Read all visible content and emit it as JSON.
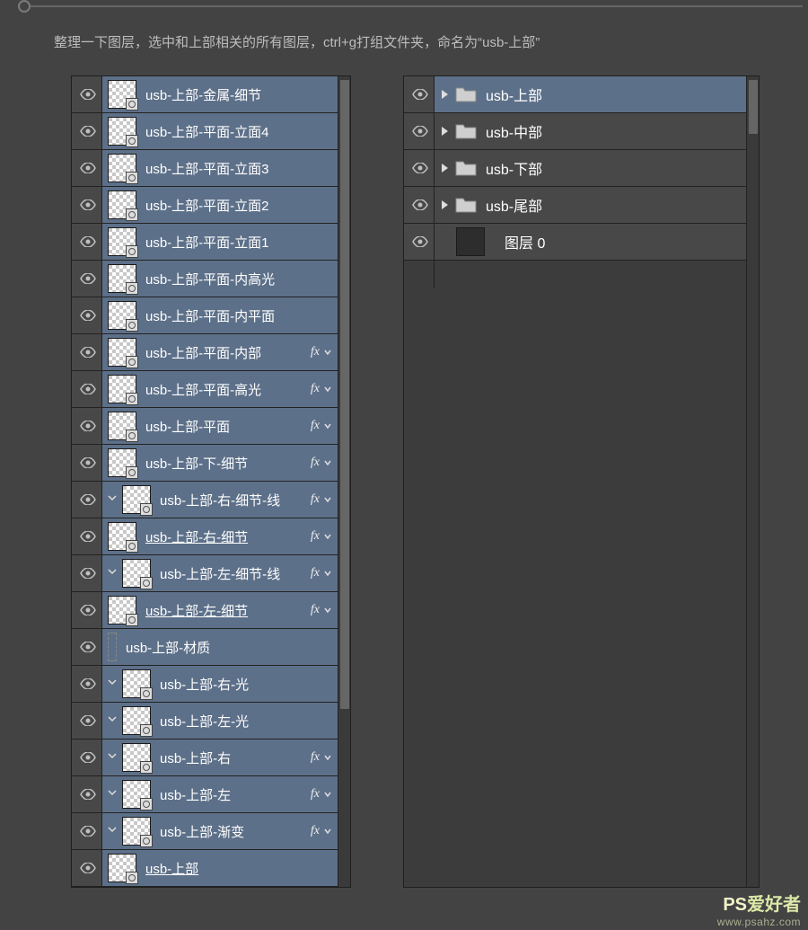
{
  "instruction": "整理一下图层，选中和上部相关的所有图层，ctrl+g打组文件夹，命名为“usb-上部”",
  "panelA": {
    "layers": [
      {
        "name": "usb-上部-金属-细节",
        "fx": false,
        "clip": false,
        "under": false,
        "mask": true
      },
      {
        "name": "usb-上部-平面-立面4",
        "fx": false,
        "clip": false,
        "under": false,
        "mask": true
      },
      {
        "name": "usb-上部-平面-立面3",
        "fx": false,
        "clip": false,
        "under": false,
        "mask": true
      },
      {
        "name": "usb-上部-平面-立面2",
        "fx": false,
        "clip": false,
        "under": false,
        "mask": true
      },
      {
        "name": "usb-上部-平面-立面1",
        "fx": false,
        "clip": false,
        "under": false,
        "mask": true
      },
      {
        "name": "usb-上部-平面-内高光",
        "fx": false,
        "clip": false,
        "under": false,
        "mask": true
      },
      {
        "name": "usb-上部-平面-内平面",
        "fx": false,
        "clip": false,
        "under": false,
        "mask": true
      },
      {
        "name": "usb-上部-平面-内部",
        "fx": true,
        "clip": false,
        "under": false,
        "mask": true
      },
      {
        "name": "usb-上部-平面-高光",
        "fx": true,
        "clip": false,
        "under": false,
        "mask": true
      },
      {
        "name": "usb-上部-平面",
        "fx": true,
        "clip": false,
        "under": false,
        "mask": true
      },
      {
        "name": "usb-上部-下-细节",
        "fx": true,
        "clip": false,
        "under": false,
        "mask": true
      },
      {
        "name": "usb-上部-右-细节-线",
        "fx": true,
        "clip": true,
        "under": false,
        "mask": true
      },
      {
        "name": "usb-上部-右-细节 ",
        "fx": true,
        "clip": false,
        "under": true,
        "mask": true
      },
      {
        "name": "usb-上部-左-细节-线",
        "fx": true,
        "clip": true,
        "under": false,
        "mask": true
      },
      {
        "name": "usb-上部-左-细节 ",
        "fx": true,
        "clip": false,
        "under": true,
        "mask": true
      },
      {
        "name": "usb-上部-材质",
        "fx": false,
        "clip": false,
        "under": false,
        "mask": false,
        "nothumb": true
      },
      {
        "name": "usb-上部-右-光",
        "fx": false,
        "clip": true,
        "under": false,
        "mask": true
      },
      {
        "name": "usb-上部-左-光",
        "fx": false,
        "clip": true,
        "under": false,
        "mask": true
      },
      {
        "name": "usb-上部-右",
        "fx": true,
        "clip": true,
        "under": false,
        "mask": true
      },
      {
        "name": "usb-上部-左",
        "fx": true,
        "clip": true,
        "under": false,
        "mask": true
      },
      {
        "name": "usb-上部-渐变",
        "fx": true,
        "clip": true,
        "under": false,
        "mask": true
      },
      {
        "name": "usb-上部 ",
        "fx": false,
        "clip": false,
        "under": true,
        "mask": true
      }
    ]
  },
  "panelB": {
    "rows": [
      {
        "type": "folder",
        "name": "usb-上部",
        "selected": true
      },
      {
        "type": "folder",
        "name": "usb-中部",
        "selected": false
      },
      {
        "type": "folder",
        "name": "usb-下部",
        "selected": false
      },
      {
        "type": "folder",
        "name": "usb-尾部",
        "selected": false
      },
      {
        "type": "layer",
        "name": "图层 0",
        "selected": false
      }
    ]
  },
  "watermark": {
    "line1a": "PS",
    "line1b": "爱好者",
    "line2": "www.psahz.com"
  }
}
